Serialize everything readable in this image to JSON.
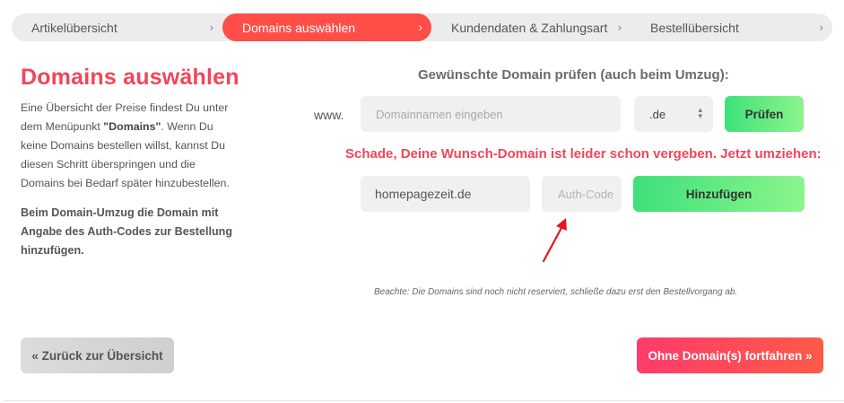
{
  "steps": [
    {
      "label": "Artikelübersicht",
      "chevron": "›",
      "active": false
    },
    {
      "label": "Domains auswählen",
      "chevron": "›",
      "active": true
    },
    {
      "label": "Kundendaten & Zahlungsart",
      "chevron": "›",
      "active": false
    },
    {
      "label": "Bestellübersicht",
      "chevron": "›",
      "active": false
    }
  ],
  "sidebar": {
    "title": "Domains auswählen",
    "text_before": "Eine Übersicht der Preise findest Du unter dem Menüpunkt ",
    "text_bold": "\"Domains\"",
    "text_after": ". Wenn Du keine Domains bestellen willst, kannst Du diesen Schritt überspringen und die Domains bei Bedarf später hinzubestellen.",
    "note_bold": "Beim Domain-Umzug die Domain mit Angabe des Auth-Codes zur Bestellung hinzufügen."
  },
  "check": {
    "title": "Gewünschte Domain prüfen (auch beim Umzug):",
    "prefix": "www.",
    "placeholder": "Domainnamen eingeben",
    "tld": ".de",
    "button": "Prüfen"
  },
  "result": {
    "message": "Schade, Deine Wunsch-Domain ist leider schon vergeben. Jetzt umziehen:",
    "domain": "homepagezeit.de",
    "auth_placeholder": "Auth-Code",
    "add_button": "Hinzufügen"
  },
  "note": "Beachte: Die Domains sind noch nicht reserviert, schließe dazu erst den Bestellvorgang ab.",
  "footer": {
    "back_button": "« Zurück zur Übersicht",
    "continue_button": "Ohne Domain(s) fortfahren »"
  },
  "colors": {
    "accent": "#ff4e48",
    "heading": "#f0465a",
    "green_start": "#3ee07a",
    "green_end": "#8cf58c",
    "annotation_arrow": "#e8141e"
  },
  "icons": {
    "step_chevron": "chevron-right-icon",
    "select_arrows": "select-updown-icon"
  }
}
